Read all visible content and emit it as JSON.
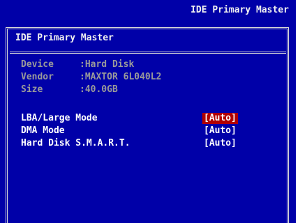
{
  "header": {
    "title": "IDE Primary Master"
  },
  "page": {
    "title": "IDE Primary Master"
  },
  "info": [
    {
      "label": "Device",
      "value": ":Hard Disk"
    },
    {
      "label": "Vendor",
      "value": ":MAXTOR 6L040L2"
    },
    {
      "label": "Size",
      "value": ":40.0GB"
    }
  ],
  "options": [
    {
      "label": "LBA/Large Mode",
      "value": "[Auto]",
      "selected": true
    },
    {
      "label": "DMA Mode",
      "value": "[Auto]",
      "selected": false
    },
    {
      "label": "Hard Disk S.M.A.R.T.",
      "value": "[Auto]",
      "selected": false
    }
  ],
  "colors": {
    "background": "#0000a8",
    "text": "#ffffff",
    "info_text": "#9a9a9a",
    "highlight": "#b00000"
  }
}
